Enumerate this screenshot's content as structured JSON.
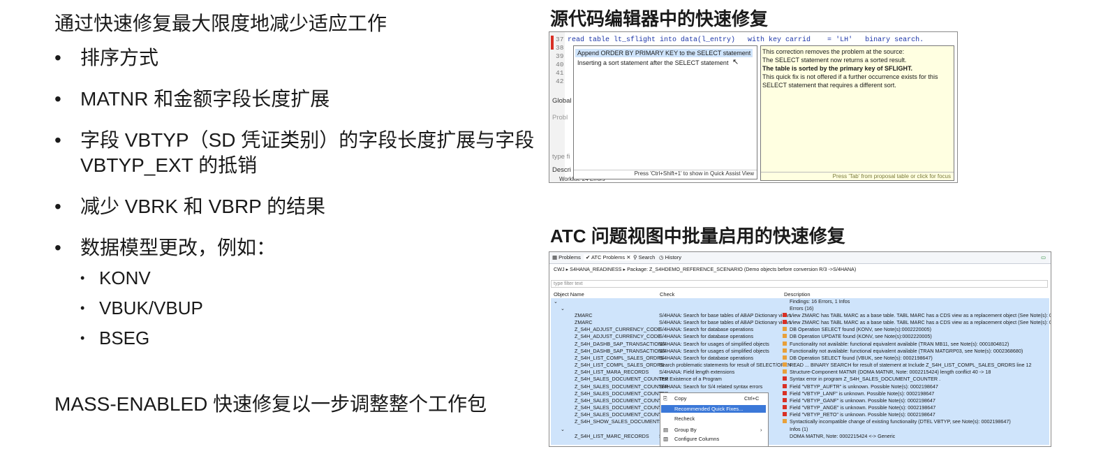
{
  "left_title": "通过快速修复最大限度地减少适应工作",
  "bullets": [
    "排序方式",
    "MATNR 和金额字段长度扩展",
    "字段 VBTYP（SD 凭证类别）的字段长度扩展与字段 VBTYP_EXT 的抵销",
    "减少 VBRK 和 VBRP 的结果",
    "数据模型更改，例如："
  ],
  "sub_bullets": [
    "KONV",
    "VBUK/VBUP",
    "BSEG"
  ],
  "bottom_title": "MASS-ENABLED 快速修复以一步调整整个工作包",
  "editor_section": {
    "heading": "源代码编辑器中的快速修复",
    "line_numbers": [
      "37",
      "38",
      "39",
      "40",
      "41",
      "42"
    ],
    "code_line": "read table lt_sflight into data(l_entry)   with key carrid    = 'LH'   binary search.",
    "proposals": [
      "Append ORDER BY PRIMARY KEY to the SELECT statement",
      "Inserting a sort statement after the SELECT statement"
    ],
    "proposal_footer": "Press 'Ctrl+Shift+1' to show in Quick Assist View",
    "info_lines": [
      "This correction removes the problem at the source:",
      "The SELECT statement now returns a sorted result.",
      "The table is sorted by the primary key of SFLIGHT.",
      "This quick fix is not offered if a further occurrence exists for this",
      " SELECT statement that requires a different sort."
    ],
    "info_footer": "Press 'Tab' from proposal table or click for focus",
    "side_labels": [
      "Global",
      "Probl",
      "type fi",
      "Descri",
      "Worklist: 24 Errors"
    ]
  },
  "atc_section": {
    "heading": "ATC 问题视图中批量启用的快速修复",
    "tabs": [
      "Problems",
      "ATC Problems",
      "Search",
      "History"
    ],
    "breadcrumb": "CWJ  ▸  S4HANA_READINESS  ▸  Package: Z_S4HDEMO_REFERENCE_SCENARIO (Demo objects before conversion R/3 ->S/4HANA)",
    "filter_placeholder": "type filter text",
    "columns": [
      "Object Name",
      "Check",
      "Description"
    ],
    "findings": "Findings: 16 Errors, 1 Infos",
    "errors_group": "Errors (16)",
    "infos_group": "Infos (1)",
    "rows": [
      {
        "obj": "ZMARC",
        "check": "S/4HANA: Search for base tables of ABAP Dictionary views",
        "desc": "View ZMARC has TABL MARC as a base table. TABL MARC has a CDS view as a replacement object (See Note(s): 0002378796)"
      },
      {
        "obj": "ZMARC",
        "check": "S/4HANA: Search for base tables of ABAP Dictionary views",
        "desc": "View ZMARC has TABL MARC as a base table. TABL MARC has a CDS view as a replacement object (See Note(s): 0002206980)"
      },
      {
        "obj": "Z_S4H_ADJUST_CURRENCY_CODE",
        "check": "S/4HANA: Search for database operations",
        "desc": "DB Operation SELECT found (KONV, see Note(s):0002220005)"
      },
      {
        "obj": "Z_S4H_ADJUST_CURRENCY_CODE",
        "check": "S/4HANA: Search for database operations",
        "desc": "DB Operation UPDATE found (KONV, see Note(s):0002220005)"
      },
      {
        "obj": "Z_S4H_DASHB_SAP_TRANSACTIONS",
        "check": "S/4HANA: Search for usages of simplified objects",
        "desc": "Functionality not available: functional equivalent available (TRAN MB11, see Note(s): 0001804812)"
      },
      {
        "obj": "Z_S4H_DASHB_SAP_TRANSACTIONS",
        "check": "S/4HANA: Search for usages of simplified objects",
        "desc": "Functionality not available: functional equivalent available (TRAN MATGRP03, see Note(s): 0002368680)"
      },
      {
        "obj": "Z_S4H_LIST_COMPL_SALES_ORDRS",
        "check": "S/4HANA: Search for database operations",
        "desc": "DB Operation SELECT found (VBUK, see Note(s): 0002198647)"
      },
      {
        "obj": "Z_S4H_LIST_COMPL_SALES_ORDRS",
        "check": "Search problematic statements for result of SELECT/OPEN",
        "desc": "READ ... BINARY SEARCH for result of statement at Include Z_S4H_LIST_COMPL_SALES_ORDRS line 12"
      },
      {
        "obj": "Z_S4H_LIST_MARA_RECORDS",
        "check": "S/4HANA: Field length extensions",
        "desc": "Structure-Component MATNR (DOMA MATNR, Note: 0002215424) length conflict 40 -> 18"
      },
      {
        "obj": "Z_S4H_SALES_DOCUMENT_COUNTER",
        "check": "Test Existence of a Program",
        "desc": "Syntax error in program Z_S4H_SALES_DOCUMENT_COUNTER ."
      },
      {
        "obj": "Z_S4H_SALES_DOCUMENT_COUNTER",
        "check": "S/4HANA: Search for S/4 related syntax errors",
        "desc": "Field \"VBTYP_AUFTR\" is unknown. Possible Note(s): 0002198647"
      },
      {
        "obj": "Z_S4H_SALES_DOCUMENT_COUNTER",
        "check": "S",
        "desc": "Field \"VBTYP_LANF\" is unknown. Possible Note(s): 0002198647"
      },
      {
        "obj": "Z_S4H_SALES_DOCUMENT_COUNTER",
        "check": "S",
        "desc": "Field \"VBTYP_GANF\" is unknown. Possible Note(s): 0002198647"
      },
      {
        "obj": "Z_S4H_SALES_DOCUMENT_COUNTER",
        "check": "S",
        "desc": "Field \"VBTYP_ANGE\" is unknown. Possible Note(s): 0002198647"
      },
      {
        "obj": "Z_S4H_SALES_DOCUMENT_COUNTER",
        "check": "S",
        "desc": "Field \"VBTYP_RETO\" is unknown. Possible Note(s): 0002198647"
      },
      {
        "obj": "Z_S4H_SHOW_SALES_DOCUMENT",
        "check": "S",
        "desc": "Syntactically incompatible change of existing functionality (DTEL VBTYP, see Note(s): 0002198647)"
      }
    ],
    "info_row": {
      "obj": "Z_S4H_LIST_MARC_RECORDS",
      "check": "S",
      "desc": "DOMA MATNR, Note: 0002215424 <-> Generic"
    },
    "context_menu": {
      "copy": "Copy",
      "copy_shortcut": "Ctrl+C",
      "recommended": "Recommended Quick Fixes...",
      "recheck": "Recheck",
      "group_by": "Group By",
      "configure": "Configure Columns"
    }
  },
  "colors": {
    "selection_blue": "#cfe4fb",
    "menu_highlight": "#3b78d8",
    "info_yellow": "#ffffe1",
    "error_red": "#d93025",
    "warning_orange": "#e8a03a",
    "code_blue": "#1c35a8"
  }
}
